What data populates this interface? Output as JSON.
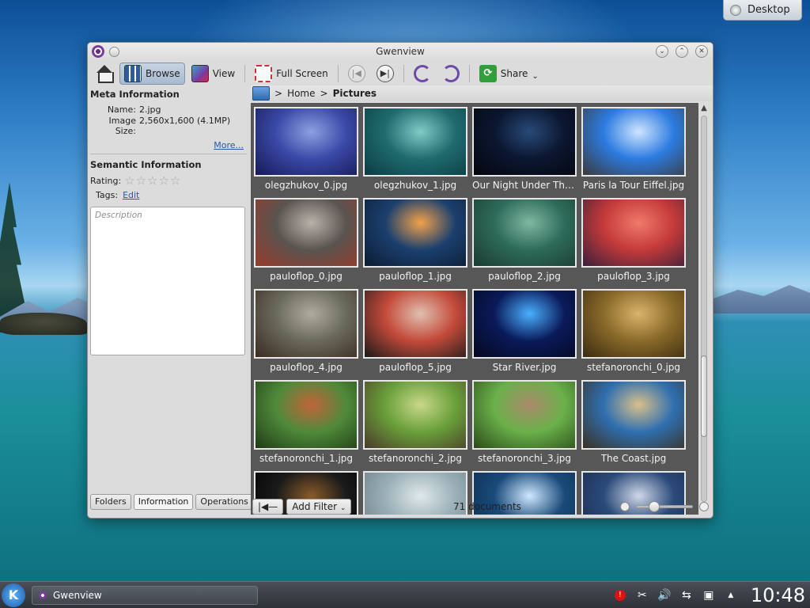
{
  "desktop": {
    "label": "Desktop"
  },
  "window": {
    "title": "Gwenview",
    "controls": [
      "⌄",
      "⌃",
      "✕"
    ]
  },
  "toolbar": {
    "browse": "Browse",
    "view": "View",
    "fullscreen": "Full Screen",
    "share": "Share",
    "share_arrow": "⌄",
    "prev_glyph": "|◀",
    "next_glyph": "▶|"
  },
  "meta": {
    "heading": "Meta Information",
    "name_label": "Name:",
    "name_value": "2.jpg",
    "size_label": "Image Size:",
    "size_value": "2,560x1,600 (4.1MP)",
    "more": "More..."
  },
  "semantic": {
    "heading": "Semantic Information",
    "rating_label": "Rating:",
    "rating_value": 0,
    "rating_max": 5,
    "star_glyph": "☆",
    "tags_label": "Tags:",
    "tags_edit": "Edit",
    "desc_placeholder": "Description"
  },
  "sidebar_tabs": [
    "Folders",
    "Information",
    "Operations"
  ],
  "breadcrumb": {
    "home": "Home",
    "sep": ">",
    "current": "Pictures"
  },
  "thumbnails": [
    {
      "name": "olegzhukov_0.jpg",
      "colors": [
        "#3b49a8",
        "#8da0e0",
        "#151a55"
      ]
    },
    {
      "name": "olegzhukov_1.jpg",
      "colors": [
        "#1f6b6e",
        "#7fcbc7",
        "#0b3c42"
      ]
    },
    {
      "name": "Our Night Under The...",
      "colors": [
        "#0b1630",
        "#284a78",
        "#05070e"
      ]
    },
    {
      "name": "Paris la Tour Eiffel.jpg",
      "colors": [
        "#2c7be0",
        "#cfe5ff",
        "#3a3a3a"
      ]
    },
    {
      "name": "pauloflop_0.jpg",
      "colors": [
        "#5a5450",
        "#b9b2aa",
        "#9a3a2a"
      ]
    },
    {
      "name": "pauloflop_1.jpg",
      "colors": [
        "#1b3f6e",
        "#f2a24a",
        "#0c1c33"
      ]
    },
    {
      "name": "pauloflop_2.jpg",
      "colors": [
        "#2e6b5a",
        "#7fb8a2",
        "#1a3a30"
      ]
    },
    {
      "name": "pauloflop_3.jpg",
      "colors": [
        "#c43a3a",
        "#f07a6a",
        "#3a1f3a"
      ]
    },
    {
      "name": "pauloflop_4.jpg",
      "colors": [
        "#6a6a5a",
        "#b0aca0",
        "#3a2a20"
      ]
    },
    {
      "name": "pauloflop_5.jpg",
      "colors": [
        "#c44a3a",
        "#e0c0b0",
        "#1a1a1a"
      ]
    },
    {
      "name": "Star River.jpg",
      "colors": [
        "#0a1a5a",
        "#4ab0ff",
        "#05081f"
      ]
    },
    {
      "name": "stefanoronchi_0.jpg",
      "colors": [
        "#8a6a2a",
        "#d9b46a",
        "#3a2a10"
      ]
    },
    {
      "name": "stefanoronchi_1.jpg",
      "colors": [
        "#4f8a3a",
        "#c2643a",
        "#1f3a16"
      ]
    },
    {
      "name": "stefanoronchi_2.jpg",
      "colors": [
        "#6aa03a",
        "#c9d88a",
        "#4a3a2a"
      ]
    },
    {
      "name": "stefanoronchi_3.jpg",
      "colors": [
        "#6ab04a",
        "#a98a6a",
        "#2a4a1a"
      ]
    },
    {
      "name": "The Coast.jpg",
      "colors": [
        "#2f6fb0",
        "#d9c08a",
        "#3a3020"
      ]
    },
    {
      "name": "",
      "colors": [
        "#1a1a1a",
        "#8a5a2a",
        "#000"
      ]
    },
    {
      "name": "",
      "colors": [
        "#9ab0b8",
        "#e0e8ea",
        "#6a7a80"
      ]
    },
    {
      "name": "",
      "colors": [
        "#1a4a7a",
        "#cfe8ff",
        "#0b2a4a"
      ]
    },
    {
      "name": "",
      "colors": [
        "#2a4a7a",
        "#d0d8e8",
        "#1a2a4a"
      ]
    }
  ],
  "status": {
    "left_btn": "|◀—",
    "add_filter": "Add Filter",
    "filter_arrow": "⌄",
    "documents": "71 documents",
    "zoom_out": "−",
    "zoom_in": "+",
    "zoom_level": 0.3
  },
  "taskbar": {
    "kickoff": "K",
    "task_label": "Gwenview",
    "clock": "10:48",
    "tray_icons": [
      "!",
      "✂",
      "🔊",
      "⇆",
      "▣",
      "▲"
    ]
  }
}
